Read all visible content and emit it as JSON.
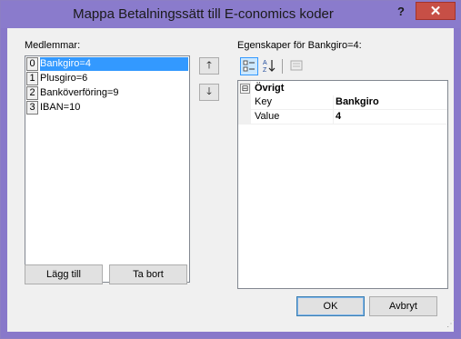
{
  "window": {
    "title": "Mappa Betalningssätt till E-conomics koder",
    "help_label": "?",
    "close_label": "✕"
  },
  "members": {
    "label": "Medlemmar:",
    "items": [
      {
        "index": "0",
        "text": "Bankgiro=4",
        "selected": true
      },
      {
        "index": "1",
        "text": "Plusgiro=6",
        "selected": false
      },
      {
        "index": "2",
        "text": "Banköverföring=9",
        "selected": false
      },
      {
        "index": "3",
        "text": "IBAN=10",
        "selected": false
      }
    ],
    "move_up_icon": "arrow-up-icon",
    "move_down_icon": "arrow-down-icon",
    "move_up_glyph": "🡑",
    "move_down_glyph": "🡓",
    "add_label": "Lägg till",
    "remove_label": "Ta bort"
  },
  "properties": {
    "label": "Egenskaper för Bankgiro=4:",
    "toolbar": {
      "categorized_icon": "categorized-icon",
      "alphabetical_icon": "sort-alphabetical-icon",
      "property_pages_icon": "property-pages-icon"
    },
    "category": {
      "expander": "⊟",
      "name": "Övrigt"
    },
    "rows": [
      {
        "name": "Key",
        "value": "Bankgiro"
      },
      {
        "name": "Value",
        "value": "4"
      }
    ]
  },
  "footer": {
    "ok_label": "OK",
    "cancel_label": "Avbryt"
  },
  "colors": {
    "titlebar": "#8a7bcc",
    "close": "#c74f46",
    "selection": "#3399ff",
    "dialog_bg": "#f0f0f0"
  }
}
